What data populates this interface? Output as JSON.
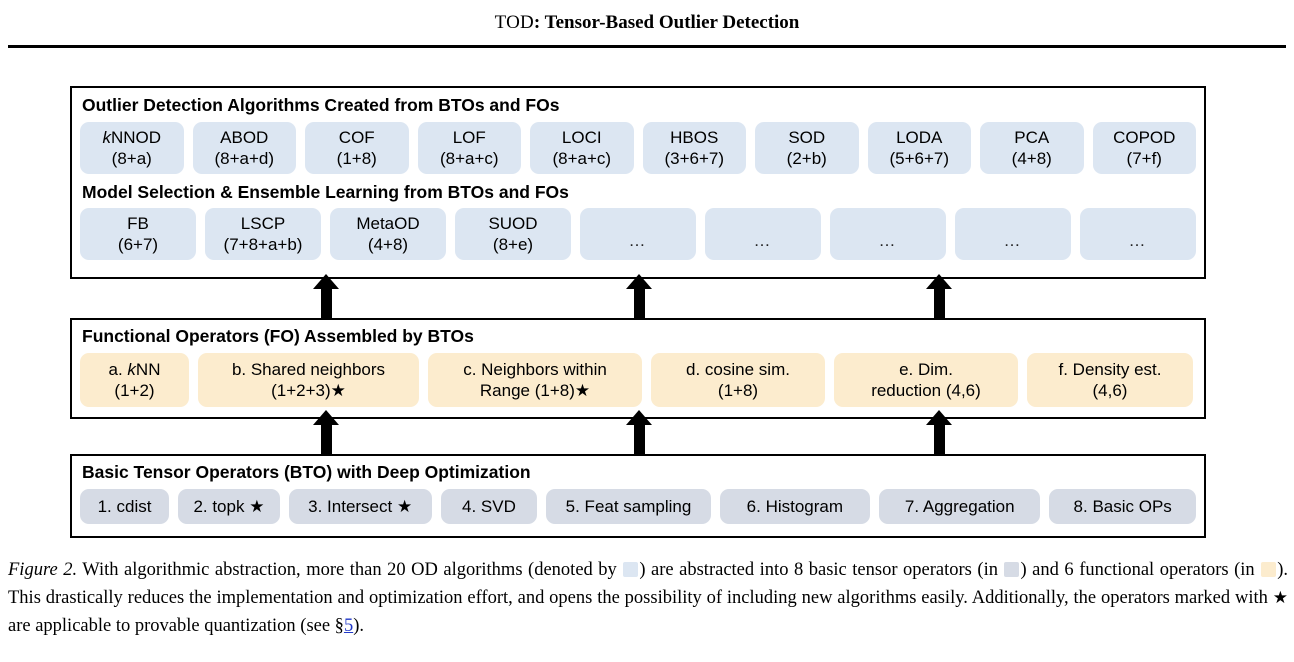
{
  "header": {
    "title_smallcaps": "TOD",
    "title_rest": ": Tensor-Based Outlier Detection"
  },
  "figure": {
    "algorithms_panel": {
      "title": "Outlier Detection Algorithms Created from BTOs and FOs",
      "items": [
        {
          "name": "kNNOD",
          "name_italic_prefix": "k",
          "name_rest": "NNOD",
          "ops": "(8+a)"
        },
        {
          "name": "ABOD",
          "ops": "(8+a+d)"
        },
        {
          "name": "COF",
          "ops": "(1+8)"
        },
        {
          "name": "LOF",
          "ops": "(8+a+c)"
        },
        {
          "name": "LOCI",
          "ops": "(8+a+c)"
        },
        {
          "name": "HBOS",
          "ops": "(3+6+7)"
        },
        {
          "name": "SOD",
          "ops": "(2+b)"
        },
        {
          "name": "LODA",
          "ops": "(5+6+7)"
        },
        {
          "name": "PCA",
          "ops": "(4+8)"
        },
        {
          "name": "COPOD",
          "ops": "(7+f)"
        }
      ]
    },
    "models_panel": {
      "title": "Model Selection & Ensemble Learning from BTOs and FOs",
      "items": [
        {
          "name": "FB",
          "ops": "(6+7)"
        },
        {
          "name": "LSCP",
          "ops": "(7+8+a+b)"
        },
        {
          "name": "MetaOD",
          "ops": "(4+8)"
        },
        {
          "name": "SUOD",
          "ops": "(8+e)"
        },
        {
          "name": "…",
          "ops": ""
        },
        {
          "name": "…",
          "ops": ""
        },
        {
          "name": "…",
          "ops": ""
        },
        {
          "name": "…",
          "ops": ""
        },
        {
          "name": "…",
          "ops": ""
        }
      ]
    },
    "fo_panel": {
      "title": "Functional Operators (FO) Assembled by BTOs",
      "items": [
        {
          "line1_pre": "a. ",
          "line1_italic": "k",
          "line1_post": "NN",
          "line2": "(1+2)"
        },
        {
          "line1": "b. Shared neighbors",
          "line2": "(1+2+3)★"
        },
        {
          "line1": "c. Neighbors within",
          "line2": "Range (1+8)★"
        },
        {
          "line1": "d. cosine sim.",
          "line2": "(1+8)"
        },
        {
          "line1": "e. Dim.",
          "line2": "reduction (4,6)"
        },
        {
          "line1": "f. Density est.",
          "line2": "(4,6)"
        }
      ]
    },
    "bto_panel": {
      "title": "Basic Tensor Operators (BTO) with Deep Optimization",
      "items": [
        {
          "label": "1. cdist"
        },
        {
          "label": "2. topk ★"
        },
        {
          "label": "3. Intersect ★"
        },
        {
          "label": "4. SVD"
        },
        {
          "label": "5. Feat sampling"
        },
        {
          "label": "6. Histogram"
        },
        {
          "label": "7. Aggregation"
        },
        {
          "label": "8. Basic OPs"
        }
      ]
    },
    "arrows": {
      "count_upper": 3,
      "count_lower": 3,
      "direction": "up"
    }
  },
  "caption": {
    "label": "Figure 2.",
    "part1": " With algorithmic abstraction, more than 20 OD algorithms (denoted by ",
    "part2": ") are abstracted into 8 basic tensor operators (in ",
    "part3": ") and 6 functional operators (in ",
    "part4": "). This drastically reduces the implementation and optimization effort, and opens the possibility of including new algorithms easily. Additionally, the operators marked with ",
    "star": "★",
    "part5": " are applicable to provable quantization (see §",
    "ref": "5",
    "part6": ")."
  },
  "colors": {
    "algorithm_chip": "#dce6f2",
    "functional_chip": "#fcecce",
    "basic_chip": "#d6dbe5",
    "link": "#2038c8",
    "border": "#000000"
  }
}
